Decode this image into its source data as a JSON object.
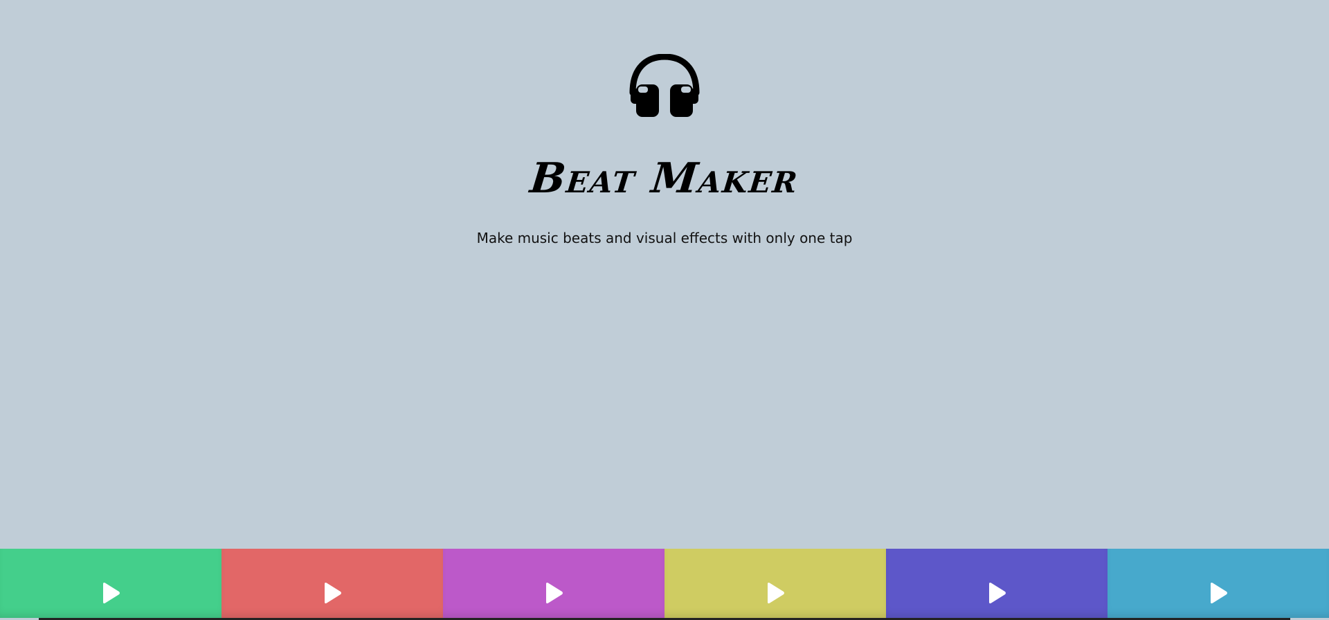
{
  "app": {
    "logo_icon": "headphones-icon",
    "title": "Beat Maker",
    "tagline": "Make music beats and visual effects with only one tap"
  },
  "colors": {
    "background": "#c0cdd7",
    "text": "#000000"
  },
  "pads": [
    {
      "id": "pad-1",
      "icon": "play-icon",
      "color": "#44cf8b"
    },
    {
      "id": "pad-2",
      "icon": "play-icon",
      "color": "#e26767"
    },
    {
      "id": "pad-3",
      "icon": "play-icon",
      "color": "#bc59c9"
    },
    {
      "id": "pad-4",
      "icon": "play-icon",
      "color": "#cfcc62"
    },
    {
      "id": "pad-5",
      "icon": "play-icon",
      "color": "#5d57c9"
    },
    {
      "id": "pad-6",
      "icon": "play-icon",
      "color": "#47a9cc"
    }
  ]
}
